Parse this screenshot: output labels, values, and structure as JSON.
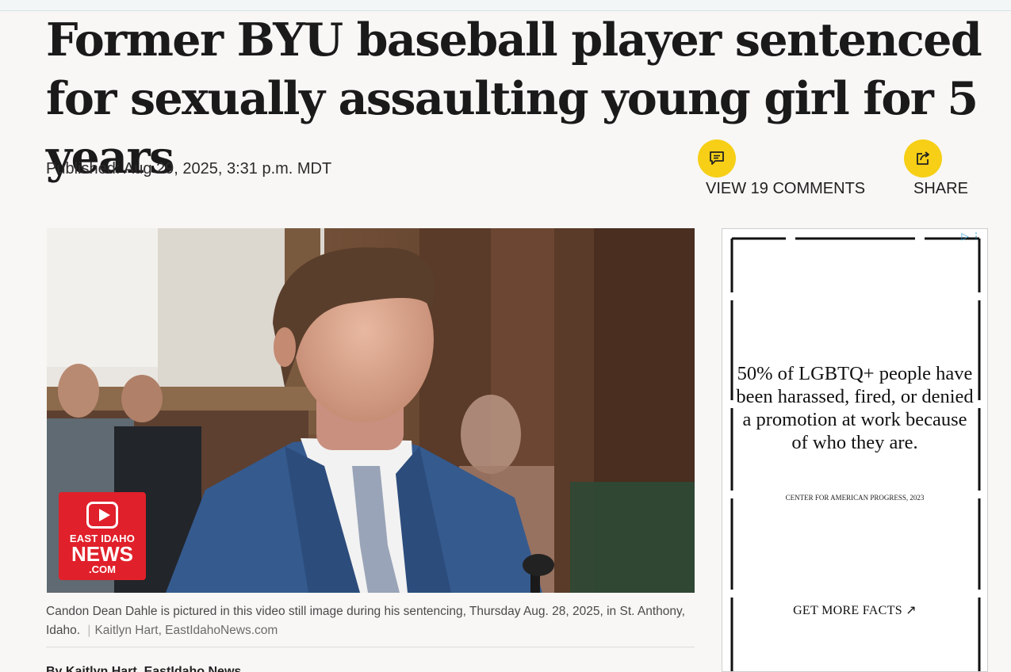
{
  "article": {
    "headline": "Former BYU baseball player sentenced for sexually assaulting young girl for 5 years",
    "published": "Published: Aug 29, 2025, 3:31 p.m. MDT",
    "comments_label": "VIEW 19 COMMENTS",
    "share_label": "SHARE",
    "caption": "Candon Dean Dahle is pictured in this video still image during his sentencing, Thursday Aug. 28, 2025, in St. Anthony, Idaho.",
    "caption_separator": "|",
    "credit": "Kaitlyn Hart, EastIdahoNews.com",
    "byline_partial": "By Kaitlyn Hart, EastIdaho News"
  },
  "image_logo": {
    "line1": "EAST IDAHO",
    "line2": "NEWS",
    "line3": ".COM"
  },
  "ad": {
    "body": "50% of LGBTQ+ people have been harassed, fired, or denied a promotion at work because of who they are.",
    "source": "CENTER FOR AMERICAN PROGRESS, 2023",
    "cta": "GET MORE FACTS ↗",
    "adchoices": "▷ ⋮"
  },
  "colors": {
    "accent_yellow": "#f6cf16",
    "logo_red": "#e0202a",
    "background": "#f8f7f5"
  },
  "icons": [
    "comment-icon",
    "share-icon",
    "external-arrow-icon",
    "adchoices-icon"
  ]
}
